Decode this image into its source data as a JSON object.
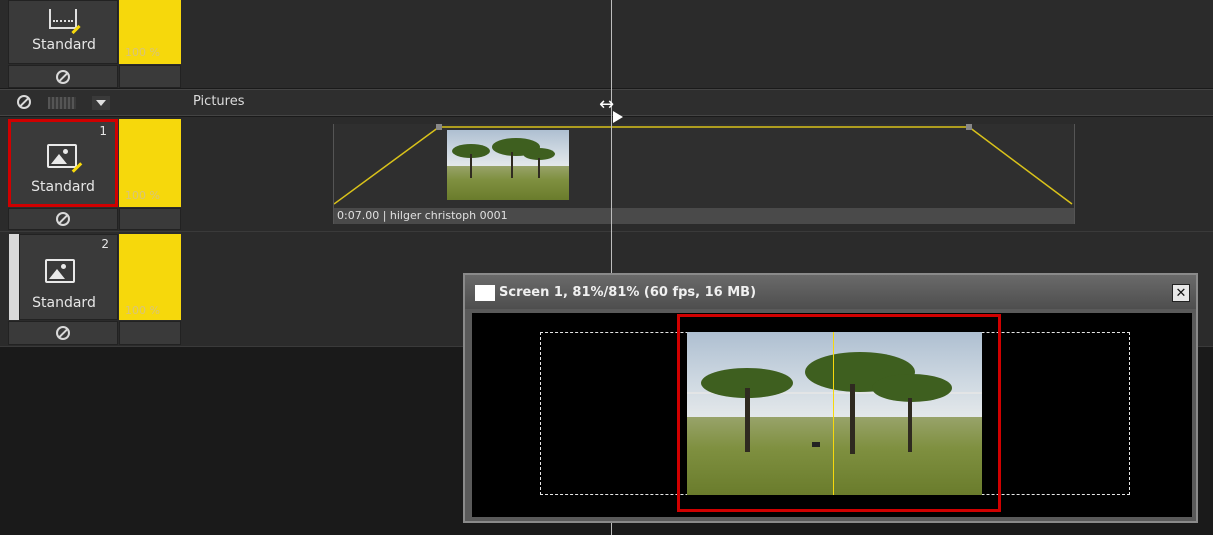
{
  "tracks": [
    {
      "number": "",
      "label": "Standard",
      "opacity": "100 %"
    },
    {
      "number": "1",
      "label": "Standard",
      "opacity": "100 %"
    },
    {
      "number": "2",
      "label": "Standard",
      "opacity": "100 %"
    }
  ],
  "group_header": {
    "title": "Pictures"
  },
  "clip": {
    "caption": "0:07.00 | hilger christoph 0001"
  },
  "preview": {
    "title": "Screen 1, 81%/81% (60 fps, 16 MB)",
    "close_symbol": "✕"
  },
  "colors": {
    "accent_yellow": "#f6d80c",
    "selection_red": "#d00000",
    "background": "#2b2b2b"
  },
  "icons": [
    "film-strip-icon",
    "picture-icon",
    "no-entry-icon",
    "dropdown-arrow-icon",
    "resize-cursor-icon",
    "window-icon",
    "close-icon"
  ]
}
